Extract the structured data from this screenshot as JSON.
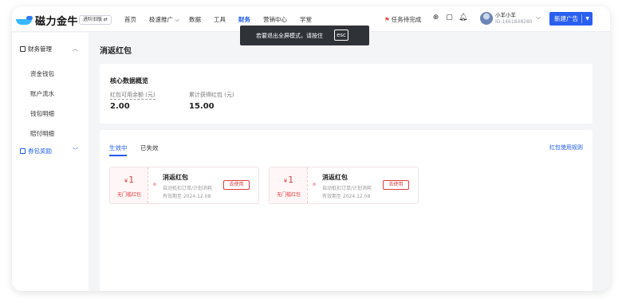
{
  "app": {
    "logo_text": "磁力金牛",
    "version_chip": "进阶旧版 ⇄"
  },
  "nav": {
    "items": [
      {
        "label": "首页"
      },
      {
        "label": "极速推广 ⌵"
      },
      {
        "label": "数据"
      },
      {
        "label": "工具"
      },
      {
        "label": "财务"
      },
      {
        "label": "营销中心"
      },
      {
        "label": "学堂"
      }
    ],
    "active": "财务"
  },
  "header_right": {
    "task_label": "任务待完成",
    "user_name": "小羊小羊",
    "user_id": "ID:1461848280",
    "new_ad_button": "新建广告"
  },
  "toast": {
    "message": "若要退出全屏模式，请按住",
    "key": "esc"
  },
  "sidebar": {
    "group_label": "财务管理",
    "items": [
      {
        "label": "资金钱包"
      },
      {
        "label": "账户流水"
      },
      {
        "label": "钱包明细"
      },
      {
        "label": "赔付明细"
      }
    ],
    "active_group_label": "券包奖励"
  },
  "page": {
    "title": "消返红包",
    "overview": {
      "title": "核心数据概览",
      "stats": [
        {
          "label": "红包可用余额 (元)",
          "value": "2.00"
        },
        {
          "label": "累计获得红包 (元)",
          "value": "15.00"
        }
      ]
    },
    "tabs": [
      {
        "label": "生效中"
      },
      {
        "label": "已失效"
      }
    ],
    "rules_link": "红包使用规则",
    "coupons": [
      {
        "currency": "¥",
        "amount": "1",
        "condition": "无门槛红包",
        "name": "消返红包",
        "desc": "自动抵扣订单/计划消耗",
        "expiry": "有效期至 2024.12.08",
        "button": "去使用"
      },
      {
        "currency": "¥",
        "amount": "1",
        "condition": "无门槛红包",
        "name": "消返红包",
        "desc": "自动抵扣订单/计划消耗",
        "expiry": "有效期至 2024.12.08",
        "button": "去使用"
      }
    ]
  },
  "colors": {
    "accent": "#1f5cf0",
    "coupon_red": "#e03a3a",
    "toast_bg": "#2f3338"
  }
}
